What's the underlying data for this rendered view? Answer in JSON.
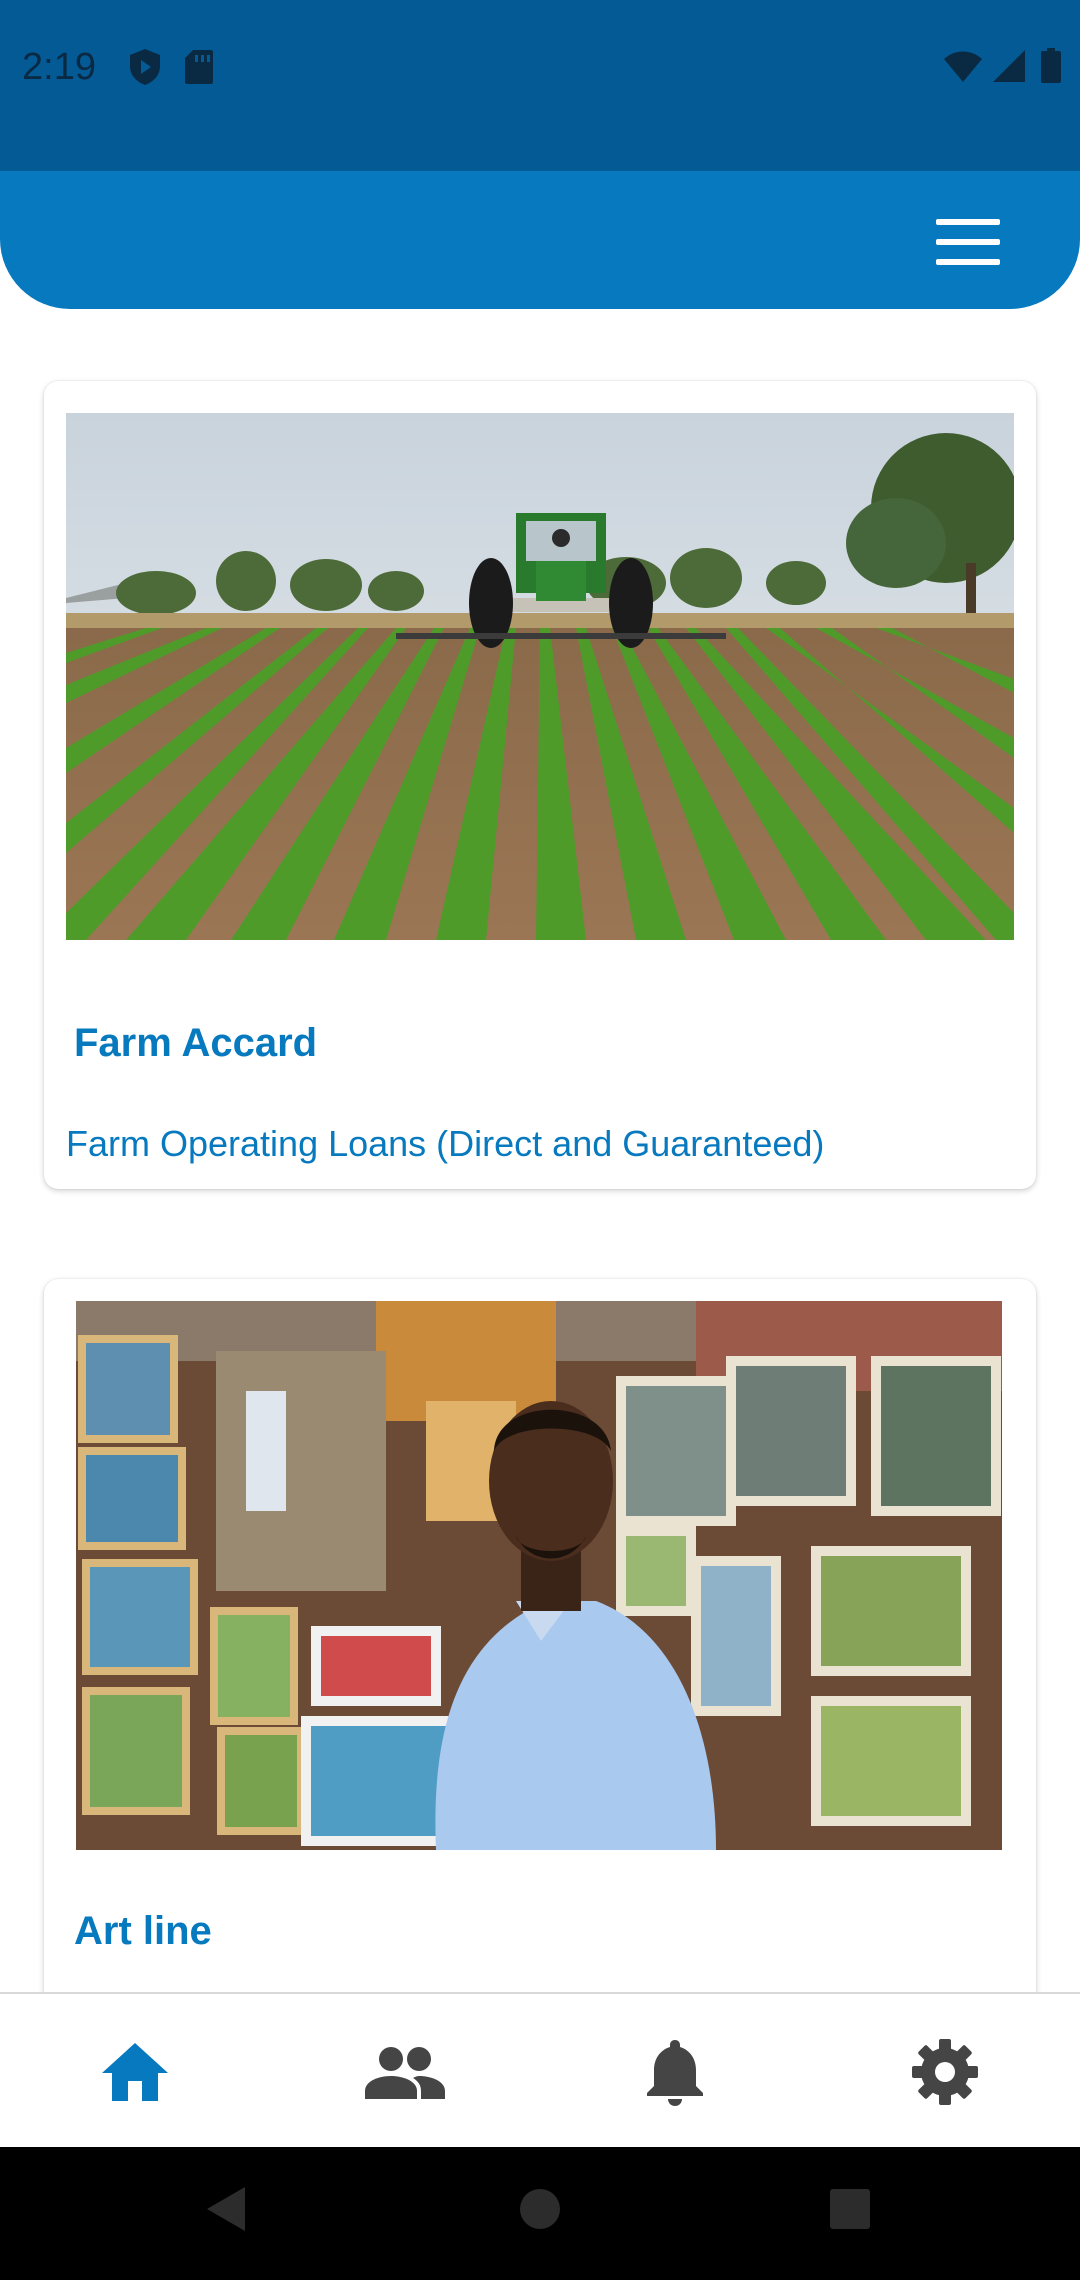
{
  "status_bar": {
    "time": "2:19",
    "left_icons": [
      "shield-icon",
      "sd-card-icon"
    ],
    "right_icons": [
      "wifi-icon",
      "signal-icon",
      "battery-icon"
    ]
  },
  "header": {
    "menu_icon": "hamburger-menu-icon",
    "background_color": "#0779be"
  },
  "cards": [
    {
      "image": "farm-tractor-field-photo",
      "title": "Farm Accard",
      "subtitle": "Farm Operating Loans (Direct and Guaranteed)"
    },
    {
      "image": "artist-gallery-photo",
      "title": "Art line"
    }
  ],
  "bottom_nav": {
    "items": [
      {
        "icon": "home-icon",
        "active": true
      },
      {
        "icon": "people-icon",
        "active": false
      },
      {
        "icon": "bell-icon",
        "active": false
      },
      {
        "icon": "gear-icon",
        "active": false
      }
    ],
    "active_color": "#0779be",
    "inactive_color": "#454545"
  },
  "system_nav": [
    "back-icon",
    "home-circle-icon",
    "recents-icon"
  ]
}
